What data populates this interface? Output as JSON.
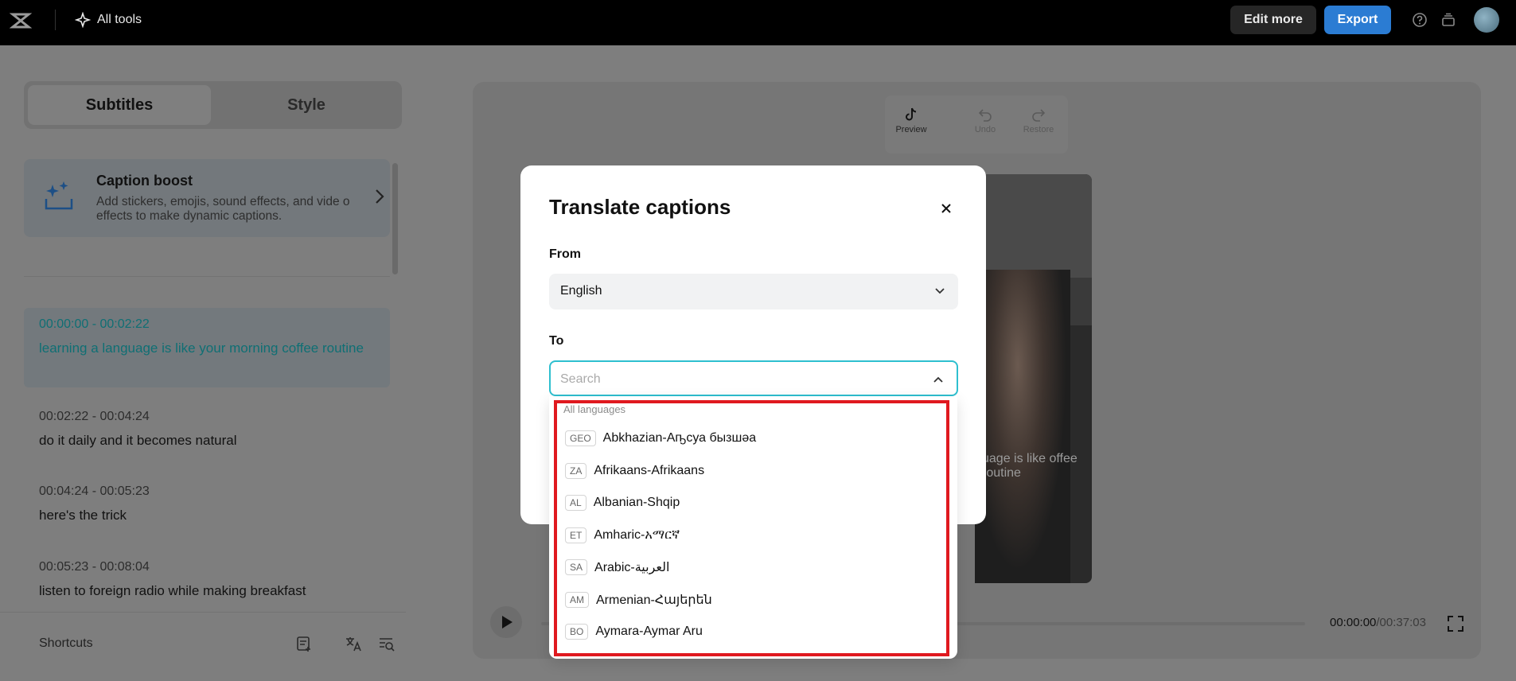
{
  "topbar": {
    "all_tools": "All tools",
    "edit_more": "Edit more",
    "export": "Export"
  },
  "left_panel": {
    "tabs": [
      "Subtitles",
      "Style"
    ],
    "caption_boost": {
      "title": "Caption boost",
      "description": "Add stickers, emojis, sound effects, and vide o effects to make dynamic captions."
    },
    "captions": [
      {
        "time": "00:00:00 - 00:02:22",
        "text": "learning a language is like your morning coffee routine"
      },
      {
        "time": "00:02:22 - 00:04:24",
        "text": "do it daily and it becomes natural"
      },
      {
        "time": "00:04:24 - 00:05:23",
        "text": "here's the trick"
      },
      {
        "time": "00:05:23 - 00:08:04",
        "text": "listen to foreign radio while making breakfast"
      }
    ],
    "shortcuts": "Shortcuts"
  },
  "preview": {
    "tools": [
      "Preview",
      "Undo",
      "Restore"
    ],
    "video_subtitle": "uage is like offee routine",
    "current_time": "00:00:00",
    "total_time": "/00:37:03"
  },
  "modal": {
    "title": "Translate captions",
    "from_label": "From",
    "from_value": "English",
    "to_label": "To",
    "search_placeholder": "Search"
  },
  "dropdown": {
    "header": "All languages",
    "items": [
      {
        "code": "GEO",
        "name": "Abkhazian-Аҧсуа бызшәа"
      },
      {
        "code": "ZA",
        "name": "Afrikaans-Afrikaans"
      },
      {
        "code": "AL",
        "name": "Albanian-Shqip"
      },
      {
        "code": "ET",
        "name": "Amharic-አማርኛ"
      },
      {
        "code": "SA",
        "name": "Arabic-العربية"
      },
      {
        "code": "AM",
        "name": "Armenian-Հայերեն"
      },
      {
        "code": "BO",
        "name": "Aymara-Aymar Aru"
      }
    ]
  },
  "colors": {
    "accent": "#2ebfcf",
    "export_blue": "#2b7cd3",
    "highlight_red": "#e0191f",
    "active_caption": "#0f6f74"
  }
}
